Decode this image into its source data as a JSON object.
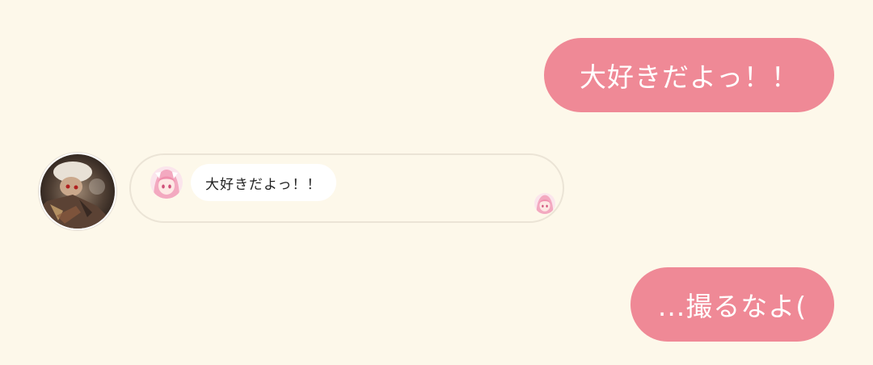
{
  "messages": [
    {
      "direction": "outgoing",
      "text": "大好きだよっ！！"
    },
    {
      "direction": "incoming",
      "avatar": "user-photo-avatar",
      "shared_card": {
        "icon": "anime-character-avatar",
        "text": "大好きだよっ！！",
        "reaction_icon": "anime-character-avatar"
      }
    },
    {
      "direction": "outgoing",
      "text": "...撮るなよ("
    }
  ],
  "colors": {
    "background": "#fdf8ea",
    "outgoing_bubble": "#ef8996",
    "outgoing_text": "#ffffff",
    "card_border": "#ebe4d6",
    "inner_bubble": "#ffffff"
  }
}
